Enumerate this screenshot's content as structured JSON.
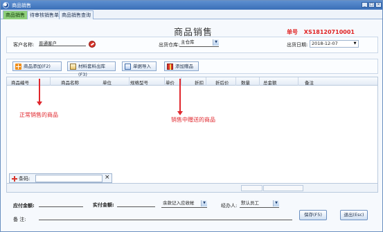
{
  "window": {
    "title": "商品销售"
  },
  "tabs": [
    "商品销售",
    "待审核销售单",
    "商品销售查询"
  ],
  "page": {
    "title": "商品销售",
    "order_label": "单号",
    "order_no": "XS18120710001"
  },
  "header": {
    "customer_label": "客户名称:",
    "customer_value": "普通客户",
    "warehouse_label": "出货仓库:",
    "warehouse_value": "主仓库",
    "date_label": "出货日期:",
    "date_value": "2018-12-07"
  },
  "toolbar": {
    "add_product": "商品添加(F2)",
    "material_out": "材料套料出库(F3)",
    "import": "单据导入",
    "add_gift": "添加赠品"
  },
  "grid": {
    "columns": [
      "商品编号",
      "商品名称",
      "单位",
      "规格型号",
      "单价",
      "折扣",
      "折后价",
      "数量",
      "总金额",
      "备注"
    ],
    "barcode_label": "条码:"
  },
  "annotations": {
    "normal": "正常销售的商品",
    "gift": "销售中赠送的商品"
  },
  "footer": {
    "payable_label": "应付金额:",
    "paid_label": "实付金额:",
    "receivable_value": "余款记入应收帐",
    "handler_label": "经办人:",
    "handler_value": "默认员工",
    "note_label": "备    注:",
    "save": "保存(F5)",
    "exit": "退出(Esc)"
  }
}
